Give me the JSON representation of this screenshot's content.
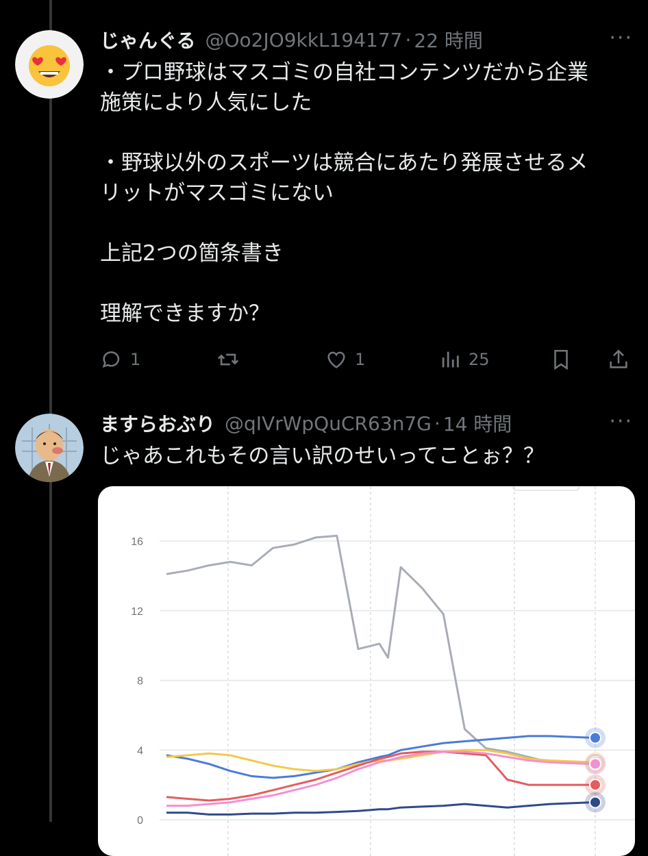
{
  "tweets": [
    {
      "display_name": "じゃんぐる",
      "handle": "@Oo2JO9kkL194177",
      "separator": "·",
      "time": "22 時間",
      "lines": [
        "・プロ野球はマスゴミの自社コンテンツだから企業",
        "施策により人気にした",
        "",
        "・野球以外のスポーツは競合にあたり発展させるメ",
        "リットがマスゴミにない",
        "",
        "上記2つの箇条書き",
        "",
        "理解できますか？"
      ],
      "actions": {
        "replies": "1",
        "retweets": "",
        "likes": "1",
        "views": "25"
      },
      "avatar_icon": "heart-eyes-emoji-icon"
    },
    {
      "display_name": "ますらおぶり",
      "handle": "@qIVrWpQuCR63n7G",
      "separator": "·",
      "time": "14 時間",
      "lines": [
        "じゃあこれもその言い訳のせいってことぉ？？"
      ],
      "avatar_icon": "cartoon-man-avatar-icon"
    }
  ],
  "chart_data": {
    "type": "line",
    "yticks": [
      "16",
      "12",
      "8",
      "4",
      "0"
    ],
    "ylim": [
      0,
      16
    ],
    "x": [
      0,
      5,
      10,
      15,
      20,
      25,
      30,
      35,
      40,
      45,
      50,
      52,
      55,
      60,
      65,
      70,
      75,
      80,
      85,
      90,
      100
    ],
    "series": [
      {
        "color": "#a8adb5",
        "values": [
          14.1,
          14.3,
          14.6,
          14.8,
          14.6,
          15.6,
          15.8,
          16.2,
          16.3,
          9.8,
          10.1,
          9.3,
          14.5,
          13.3,
          11.8,
          5.2,
          4.1,
          3.9,
          3.6,
          3.3,
          3.2
        ]
      },
      {
        "color": "#4a7bd8",
        "values": [
          3.7,
          3.5,
          3.2,
          2.8,
          2.5,
          2.4,
          2.5,
          2.7,
          2.9,
          3.3,
          3.6,
          3.7,
          4.0,
          4.2,
          4.4,
          4.5,
          4.6,
          4.7,
          4.8,
          4.8,
          4.7
        ]
      },
      {
        "color": "#f2c94c",
        "values": [
          3.6,
          3.7,
          3.8,
          3.7,
          3.4,
          3.1,
          2.9,
          2.8,
          2.9,
          3.2,
          3.4,
          3.4,
          3.5,
          3.7,
          3.9,
          4.0,
          4.0,
          3.8,
          3.5,
          3.4,
          3.3
        ]
      },
      {
        "color": "#e45c5c",
        "values": [
          1.3,
          1.2,
          1.1,
          1.2,
          1.4,
          1.7,
          2.0,
          2.3,
          2.7,
          3.1,
          3.5,
          3.6,
          3.8,
          3.9,
          3.9,
          3.8,
          3.7,
          2.3,
          2.0,
          2.0,
          2.0
        ]
      },
      {
        "color": "#f48fd0",
        "values": [
          0.8,
          0.8,
          0.9,
          1.0,
          1.2,
          1.4,
          1.7,
          2.0,
          2.4,
          2.9,
          3.3,
          3.4,
          3.6,
          3.8,
          3.9,
          3.9,
          3.8,
          3.6,
          3.4,
          3.3,
          3.2
        ]
      },
      {
        "color": "#2f4a8a",
        "values": [
          0.4,
          0.4,
          0.3,
          0.3,
          0.35,
          0.35,
          0.4,
          0.4,
          0.45,
          0.5,
          0.6,
          0.6,
          0.7,
          0.75,
          0.8,
          0.9,
          0.8,
          0.7,
          0.8,
          0.9,
          1.0
        ]
      }
    ],
    "grid": true
  }
}
